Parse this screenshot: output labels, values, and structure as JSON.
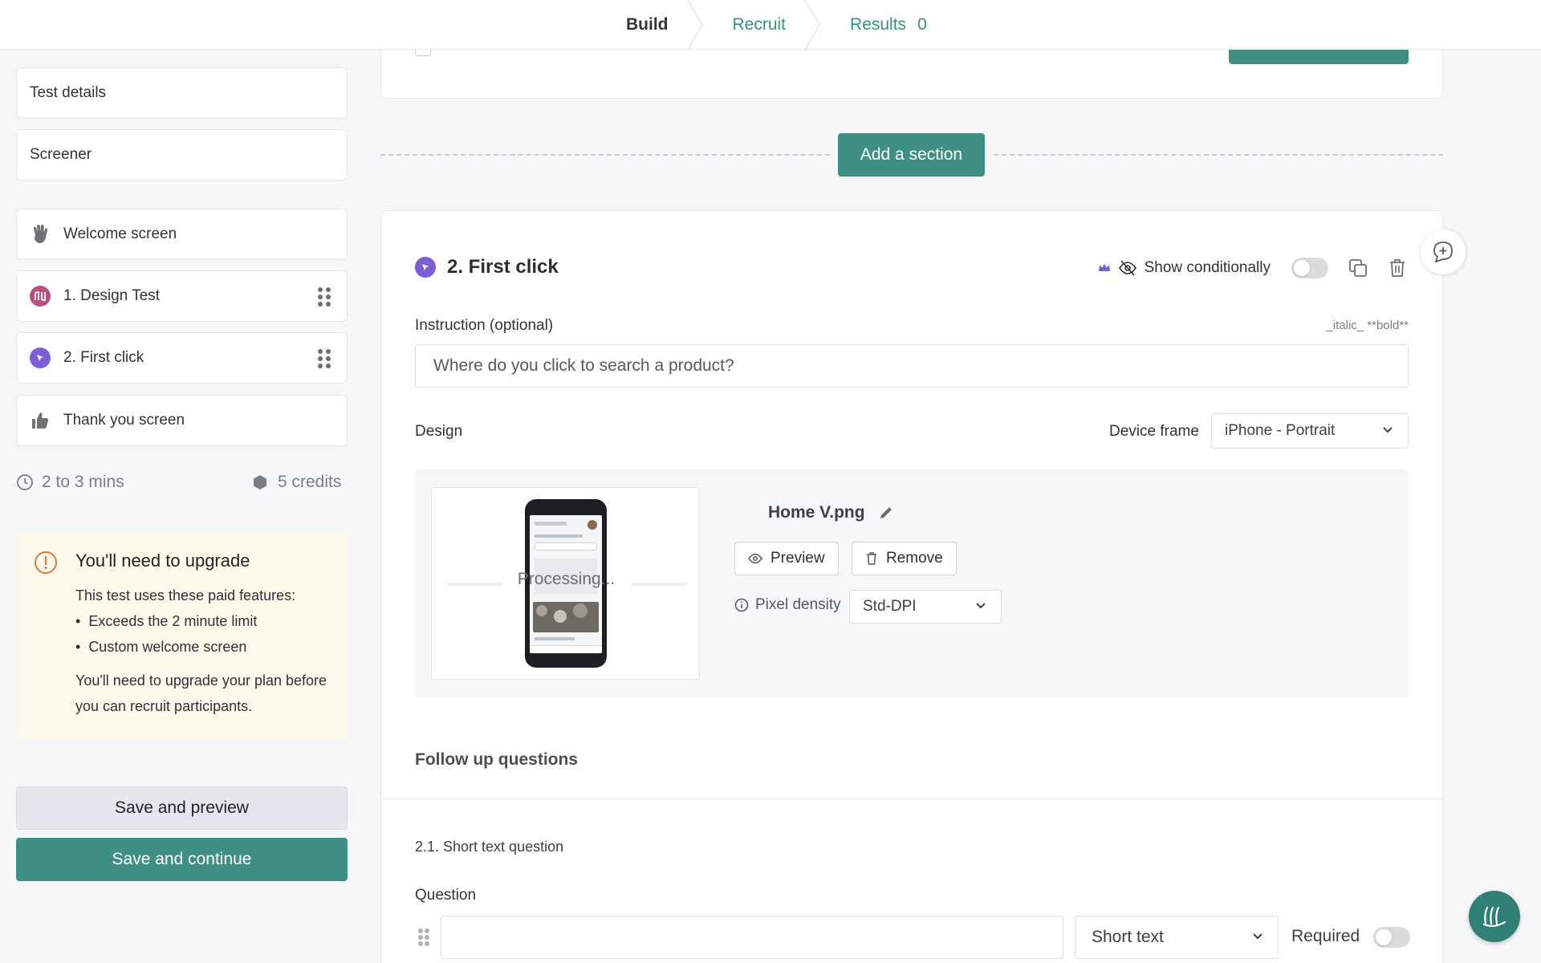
{
  "nav": {
    "tabs": [
      {
        "label": "Build",
        "active": true
      },
      {
        "label": "Recruit",
        "active": false
      },
      {
        "label": "Results",
        "count": "0",
        "active": false
      }
    ]
  },
  "sidebar": {
    "items": [
      {
        "label": "Test details"
      },
      {
        "label": "Screener"
      },
      {
        "label": "Welcome screen",
        "icon": "wave-hand-icon"
      },
      {
        "label": "1. Design Test",
        "icon": "design-test-icon",
        "color": "#b84f83"
      },
      {
        "label": "2. First click",
        "icon": "cursor-click-icon",
        "color": "#7b5ed4"
      },
      {
        "label": "Thank you screen",
        "icon": "thumbs-up-icon"
      }
    ],
    "duration": "2 to 3 mins",
    "credits": "5 credits",
    "upgrade": {
      "title": "You'll need to upgrade",
      "intro": "This test uses these paid features:",
      "features": [
        "Exceeds the 2 minute limit",
        "Custom welcome screen"
      ],
      "note": "You'll need to upgrade your plan before you can recruit participants."
    },
    "save_preview": "Save and preview",
    "save_continue": "Save and continue"
  },
  "main": {
    "add_section": "Add a section",
    "question": {
      "title": "2. First click",
      "show_conditionally": "Show conditionally",
      "instruction_label": "Instruction (optional)",
      "format_hint": "_italic_ **bold**",
      "instruction_value": "Where do you click to search a product?",
      "design_label": "Design",
      "device_frame_label": "Device frame",
      "device_frame_value": "iPhone - Portrait",
      "processing": "Processing...",
      "file_name": "Home V.png",
      "preview": "Preview",
      "remove": "Remove",
      "pixel_density_label": "Pixel density",
      "pixel_density_value": "Std-DPI",
      "follow_up_title": "Follow up questions"
    },
    "follow_up": {
      "title": "2.1. Short text question",
      "question_label": "Question",
      "question_value": "",
      "type_value": "Short text",
      "required_label": "Required"
    }
  },
  "colors": {
    "accent": "#3f8f84",
    "upgrade_bg": "#fdf9eb",
    "first_click": "#7b5ed4",
    "design_test": "#b84f83"
  }
}
